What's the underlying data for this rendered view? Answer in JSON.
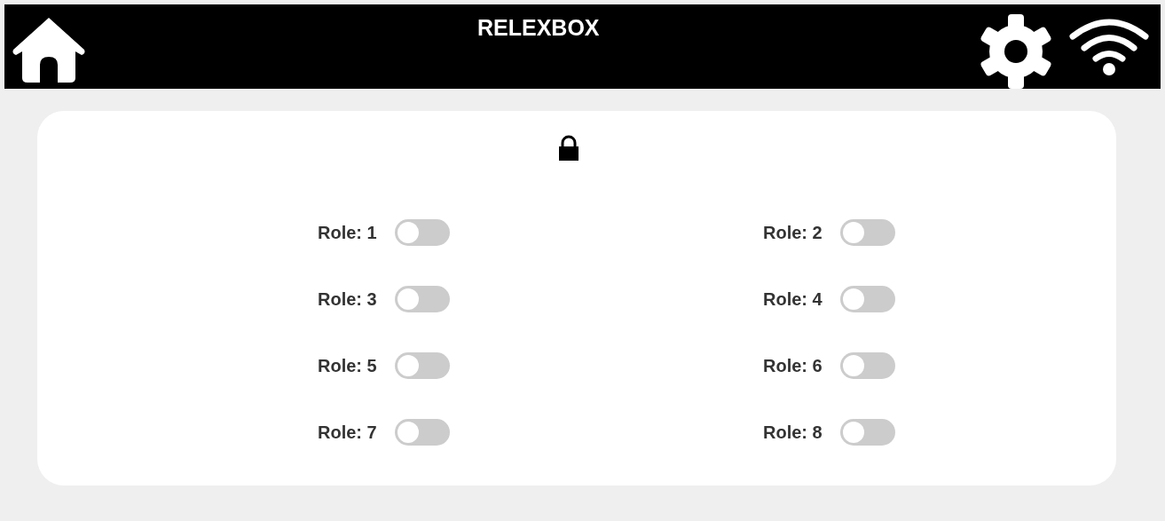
{
  "header": {
    "title": "RELEXBOX"
  },
  "roles": [
    {
      "label": "Role: 1",
      "on": false
    },
    {
      "label": "Role: 2",
      "on": false
    },
    {
      "label": "Role: 3",
      "on": false
    },
    {
      "label": "Role: 4",
      "on": false
    },
    {
      "label": "Role: 5",
      "on": false
    },
    {
      "label": "Role: 6",
      "on": false
    },
    {
      "label": "Role: 7",
      "on": false
    },
    {
      "label": "Role: 8",
      "on": false
    }
  ]
}
